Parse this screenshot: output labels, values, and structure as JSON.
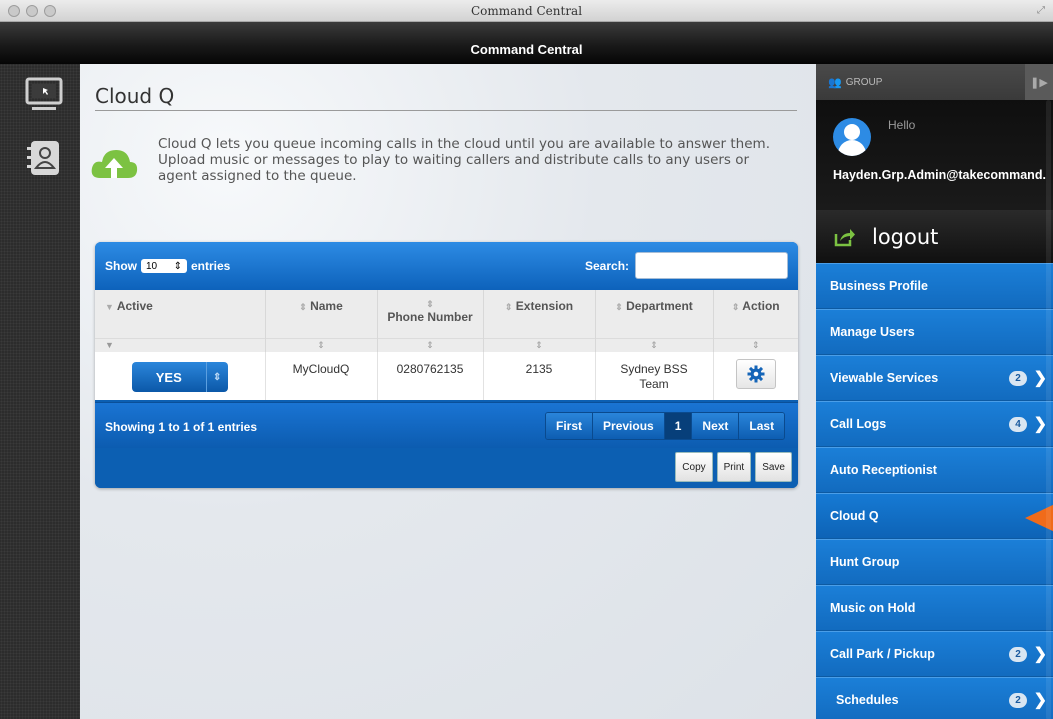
{
  "window": {
    "title": "Command Central"
  },
  "app": {
    "header_title": "Command Central"
  },
  "page": {
    "title": "Cloud Q",
    "description": "Cloud Q lets you queue incoming calls in the cloud until you are available to answer them. Upload music or messages to play to waiting callers and distribute calls to any users or agent assigned to the queue."
  },
  "table": {
    "show_label": "Show",
    "entries_value": "10",
    "entries_label": "entries",
    "search_label": "Search:",
    "search_value": "",
    "columns": [
      {
        "label": "Active",
        "sort_icon": "▼"
      },
      {
        "label": "Name",
        "sort_icon": "⇕"
      },
      {
        "label": "Phone Number",
        "sort_icon": "⇕"
      },
      {
        "label": "Extension",
        "sort_icon": "⇕"
      },
      {
        "label": "Department",
        "sort_icon": "⇕"
      },
      {
        "label": "Action",
        "sort_icon": "⇕"
      }
    ],
    "filter_row": [
      "▼",
      "⇕",
      "⇕",
      "⇕",
      "⇕",
      "⇕"
    ],
    "rows": [
      {
        "active": "YES",
        "name": "MyCloudQ",
        "phone": "0280762135",
        "extension": "2135",
        "department": "Sydney BSS Team",
        "action_icon": "gear-icon"
      }
    ],
    "info": "Showing 1 to 1 of 1 entries",
    "pagination": {
      "first": "First",
      "previous": "Previous",
      "current": "1",
      "next": "Next",
      "last": "Last"
    },
    "tools": {
      "copy": "Copy",
      "print": "Print",
      "save": "Save"
    }
  },
  "sidebar": {
    "group_label": "GROUP",
    "hello": "Hello",
    "username": "Hayden.Grp.Admin@takecommand.",
    "logout": "logout",
    "items": [
      {
        "label": "Business Profile",
        "badge": "",
        "chevron": false
      },
      {
        "label": "Manage Users",
        "badge": "",
        "chevron": false
      },
      {
        "label": "Viewable Services",
        "badge": "2",
        "chevron": true
      },
      {
        "label": "Call Logs",
        "badge": "4",
        "chevron": true
      },
      {
        "label": "Auto Receptionist",
        "badge": "",
        "chevron": false
      },
      {
        "label": "Cloud Q",
        "badge": "",
        "chevron": false,
        "active": true
      },
      {
        "label": "Hunt Group",
        "badge": "",
        "chevron": false
      },
      {
        "label": "Music on Hold",
        "badge": "",
        "chevron": false
      },
      {
        "label": "Call Park / Pickup",
        "badge": "2",
        "chevron": true
      },
      {
        "label": "Schedules",
        "badge": "2",
        "chevron": true
      }
    ]
  },
  "colors": {
    "accent_blue": "#1b7fd8",
    "active_marker": "#f06b1a",
    "cloud_green": "#7cc242"
  }
}
